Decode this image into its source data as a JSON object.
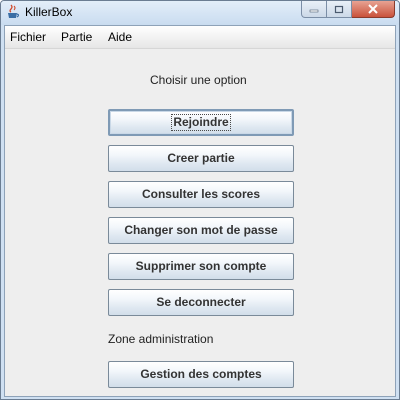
{
  "window": {
    "title": "KillerBox"
  },
  "menubar": {
    "items": [
      "Fichier",
      "Partie",
      "Aide"
    ]
  },
  "main": {
    "heading": "Choisir une option",
    "buttons": [
      "Rejoindre",
      "Creer partie",
      "Consulter les scores",
      "Changer son mot de passe",
      "Supprimer son compte",
      "Se deconnecter"
    ],
    "admin_label": "Zone administration",
    "admin_button": "Gestion des comptes"
  },
  "colors": {
    "close_button": "#c9523b",
    "titlebar": "#cfe0f2",
    "panel_background": "#eeeeee"
  },
  "icons": {
    "app": "java-cup-icon",
    "minimize": "minimize-icon",
    "maximize": "maximize-icon",
    "close": "close-icon"
  }
}
